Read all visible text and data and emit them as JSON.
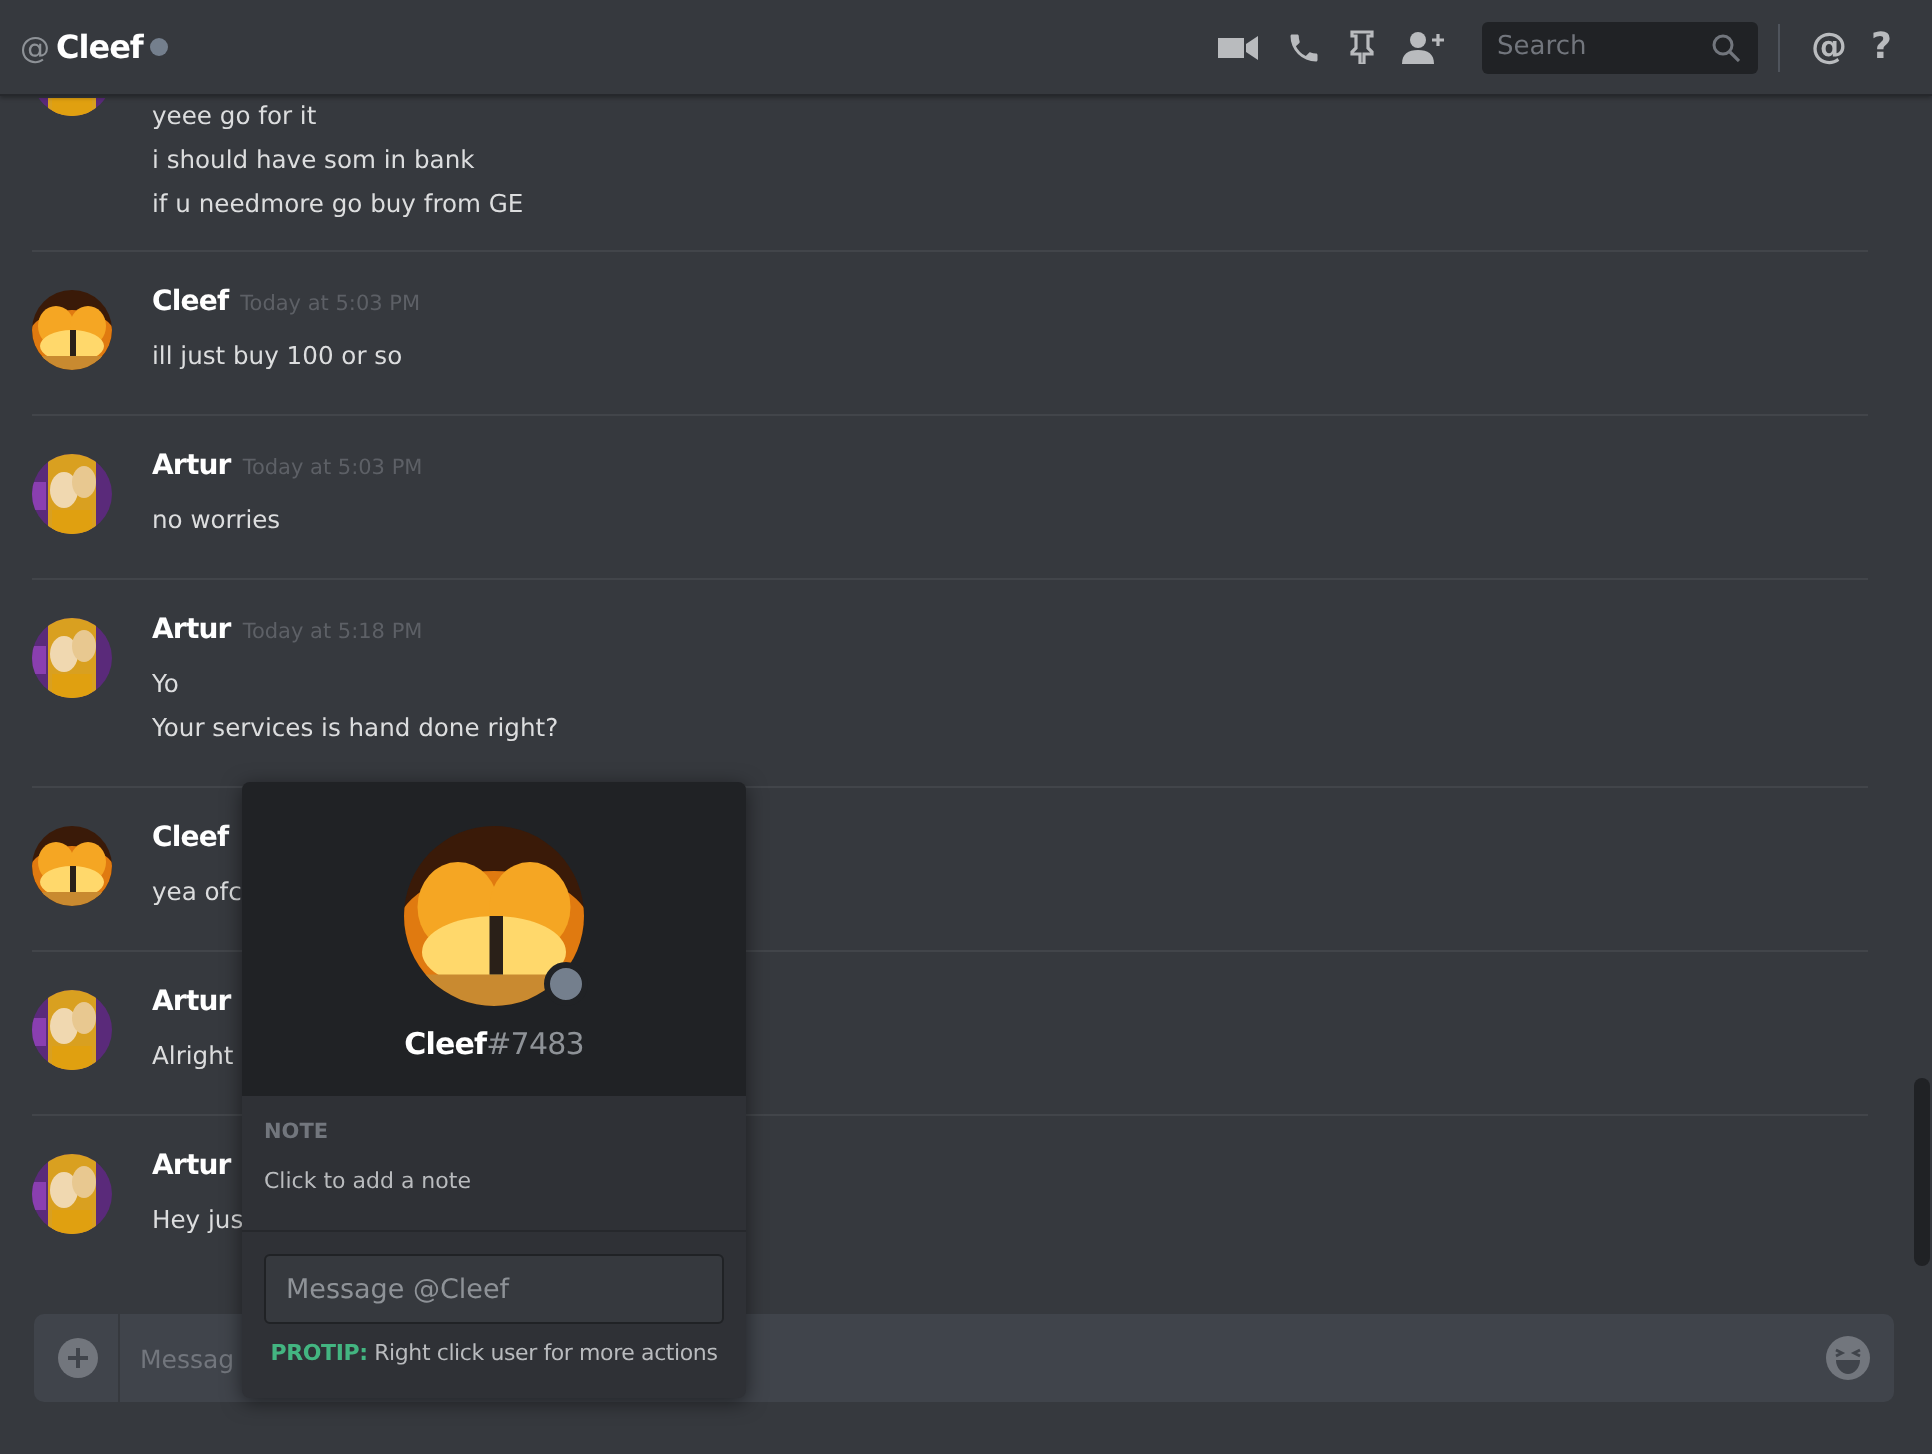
{
  "header": {
    "at_sign": "@",
    "channel_name": "Cleef",
    "online": false,
    "search": {
      "placeholder": "Search"
    },
    "mention_button": "@",
    "help_button": "?"
  },
  "messages": [
    {
      "lines": [
        "yeee go for it",
        "i should have som in bank",
        "if u needmore go buy from GE"
      ]
    },
    {
      "author": "Cleef",
      "time": "Today at 5:03 PM",
      "lines": [
        "ill just buy 100 or so"
      ]
    },
    {
      "author": "Artur",
      "time": "Today at 5:03 PM",
      "lines": [
        "no worries"
      ]
    },
    {
      "author": "Artur",
      "time": "Today at 5:18 PM",
      "lines": [
        "Yo",
        "Your services is hand done right?"
      ]
    },
    {
      "author": "Cleef",
      "lines": [
        "yea ofc"
      ]
    },
    {
      "author": "Artur",
      "lines": [
        "Alright"
      ]
    },
    {
      "author": "Artur",
      "lines": [
        "Hey jus"
      ]
    }
  ],
  "composer": {
    "placeholder": "Messag"
  },
  "popout": {
    "user_tag": "**Cleef**#7483",
    "online": false,
    "note_label": "NOTE",
    "note_placeholder": "Click to add a note",
    "message_placeholder": "Message @Cleef",
    "protip": "**PROTIP:** Right click user for more actions"
  }
}
